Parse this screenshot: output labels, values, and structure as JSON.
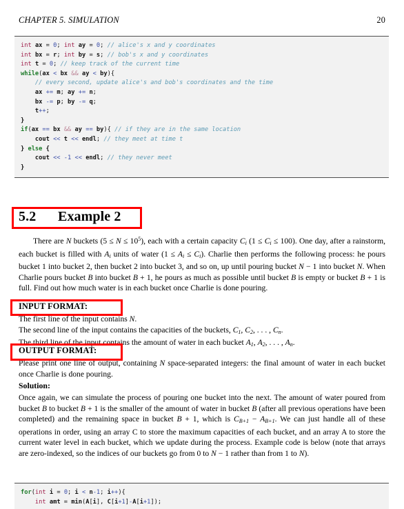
{
  "page": {
    "running_header": "CHAPTER 5.  SIMULATION",
    "page_number": "20"
  },
  "listing_top": {
    "language": "cpp",
    "lines": [
      "int ax = 0; int ay = 0; // alice's x and y coordinates",
      "int bx = r; int by = s; // bob's x and y coordinates",
      "int t = 0; // keep track of the current time",
      "while(ax < bx && ay < by){",
      "    // every second, update alice's and bob's coordinates and the time",
      "    ax += m; ay += n;",
      "    bx -= p; by -= q;",
      "    t++;",
      "}",
      "if(ax == bx && ay == by){ // if they are in the same location",
      "    cout << t << endl; // they meet at time t",
      "} else {",
      "    cout << -1 << endl; // they never meet",
      "}"
    ]
  },
  "section": {
    "number": "5.2",
    "title": "Example 2"
  },
  "problem": {
    "paragraph_plain": "There are N buckets (5 ≤ N ≤ 10^5), each with a certain capacity C_i (1 ≤ C_i ≤ 100). One day, after a rainstorm, each bucket is filled with A_i units of water (1 ≤ A_i ≤ C_i). Charlie then performs the following process: he pours bucket 1 into bucket 2, then bucket 2 into bucket 3, and so on, up until pouring bucket N − 1 into bucket N. When Charlie pours bucket B into bucket B + 1, he pours as much as possible until bucket B is empty or bucket B + 1 is full. Find out how much water is in each bucket once Charlie is done pouring."
  },
  "input_format": {
    "heading": "INPUT FORMAT:",
    "lines": [
      "The first line of the input contains N.",
      "The second line of the input contains the capacities of the buckets, C1, C2, . . . , Cn.",
      "The third line of the input contains the amount of water in each bucket A1, A2, . . . , An."
    ]
  },
  "output_format": {
    "heading": "OUTPUT FORMAT:",
    "paragraph_plain": "Please print one line of output, containing N space-separated integers: the final amount of water in each bucket once Charlie is done pouring."
  },
  "solution": {
    "heading": "Solution:",
    "paragraph_plain": "Once again, we can simulate the process of pouring one bucket into the next. The amount of water poured from bucket B to bucket B + 1 is the smaller of the amount of water in bucket B (after all previous operations have been completed) and the remaining space in bucket B + 1, which is C_{B+1} − A_{B+1}. We can just handle all of these operations in order, using an array C to store the maximum capacities of each bucket, and an array A to store the current water level in each bucket, which we update during the process. Example code is below (note that arrays are zero-indexed, so the indices of our buckets go from 0 to N − 1 rather than from 1 to N)."
  },
  "listing_bottom": {
    "language": "cpp",
    "lines": [
      "for(int i = 0; i < n-1; i++){",
      "    int amt = min(A[i], C[i+1]-A[i+1]);"
    ]
  },
  "annotations": {
    "color": "#ff0000",
    "boxes": [
      {
        "label": "Example 2 heading highlight"
      },
      {
        "label": "INPUT FORMAT highlight"
      },
      {
        "label": "OUTPUT FORMAT highlight"
      }
    ]
  }
}
